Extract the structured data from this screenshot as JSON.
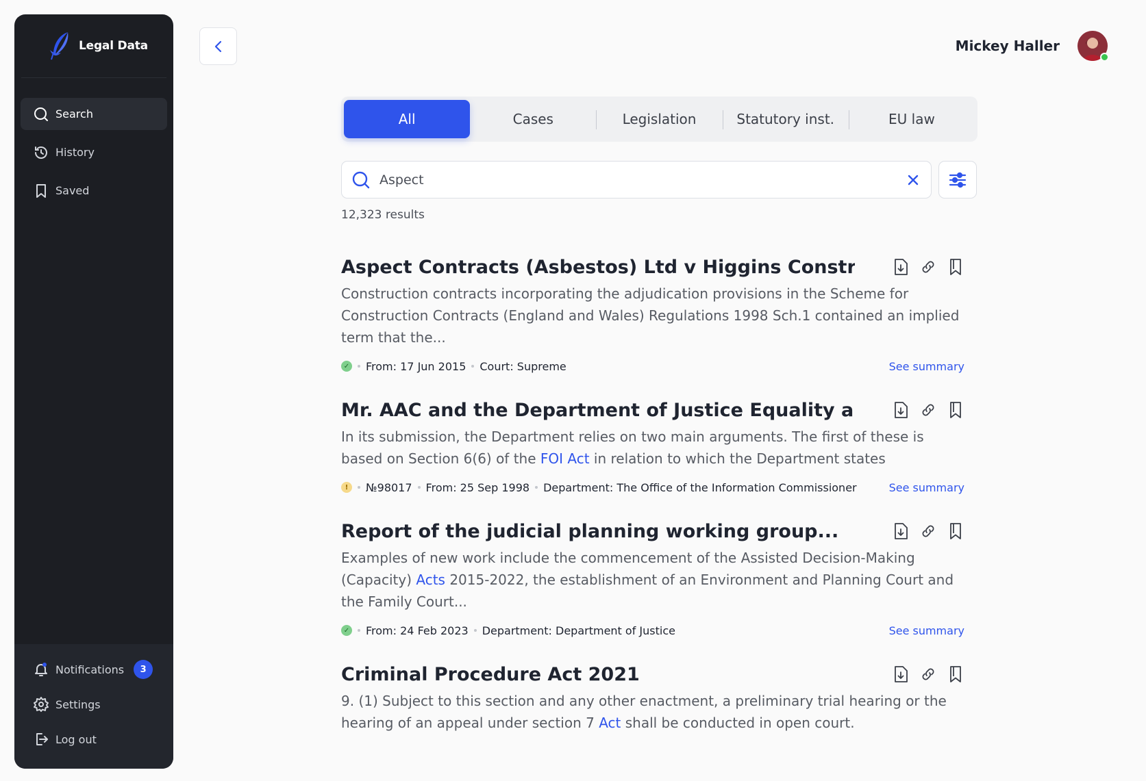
{
  "brand": {
    "name": "Legal Data"
  },
  "nav": {
    "search": "Search",
    "history": "History",
    "saved": "Saved",
    "notifications": "Notifications",
    "notifications_count": "3",
    "settings": "Settings",
    "logout": "Log out"
  },
  "user": {
    "name": "Mickey Haller"
  },
  "tabs": [
    "All",
    "Cases",
    "Legislation",
    "Statutory inst.",
    "EU law"
  ],
  "search": {
    "value": "Aspect",
    "results": "12,323 results"
  },
  "results": [
    {
      "title": "Aspect Contracts (Asbestos) Ltd v Higgins Constru...",
      "snippet_pre": "Construction contracts incorporating the adjudication provisions in the Scheme for Construction Contracts (England and Wales) Regulations 1998 Sch.1 contained an implied term that the...",
      "snippet_link": "",
      "snippet_post": "",
      "status": "ok",
      "meta": [
        "From: 17 Jun 2015",
        "Court: Supreme"
      ],
      "summary": "See summary"
    },
    {
      "title": "Mr. AAC and the Department of Justice Equality an...",
      "snippet_pre": "In its submission, the Department relies on two main arguments. The first of these is based on Section 6(6) of the ",
      "snippet_link": "FOI Act",
      "snippet_post": " in relation to which the Department states",
      "status": "warn",
      "meta": [
        "№98017",
        "From: 25 Sep 1998",
        "Department: The Office of the Information Commissioner"
      ],
      "summary": "See summary"
    },
    {
      "title": "Report of the judicial planning working group...",
      "snippet_pre": "Examples of new work include the commencement of the Assisted Decision-Making (Capacity) ",
      "snippet_link": "Acts",
      "snippet_post": " 2015-2022, the establishment of an Environment and Planning Court and the Family Court...",
      "status": "ok",
      "meta": [
        "From: 24 Feb 2023",
        "Department: Department of Justice"
      ],
      "summary": "See summary"
    },
    {
      "title": "Criminal Procedure Act 2021",
      "snippet_pre": "9. (1) Subject to this section and any other enactment, a preliminary trial hearing or the hearing of an appeal under section 7 ",
      "snippet_link": "Act",
      "snippet_post": " shall be conducted in open court.",
      "status": "",
      "meta": [],
      "summary": ""
    }
  ],
  "colors": {
    "accent": "#2f54eb",
    "sidebar": "#1c1e23",
    "online": "#3ac34f"
  },
  "icons": [
    "feather-logo-icon",
    "search-icon",
    "history-icon",
    "bookmark-icon",
    "bell-icon",
    "gear-icon",
    "logout-icon",
    "chevron-left-icon",
    "close-icon",
    "sliders-icon",
    "download-file-icon",
    "link-icon"
  ]
}
